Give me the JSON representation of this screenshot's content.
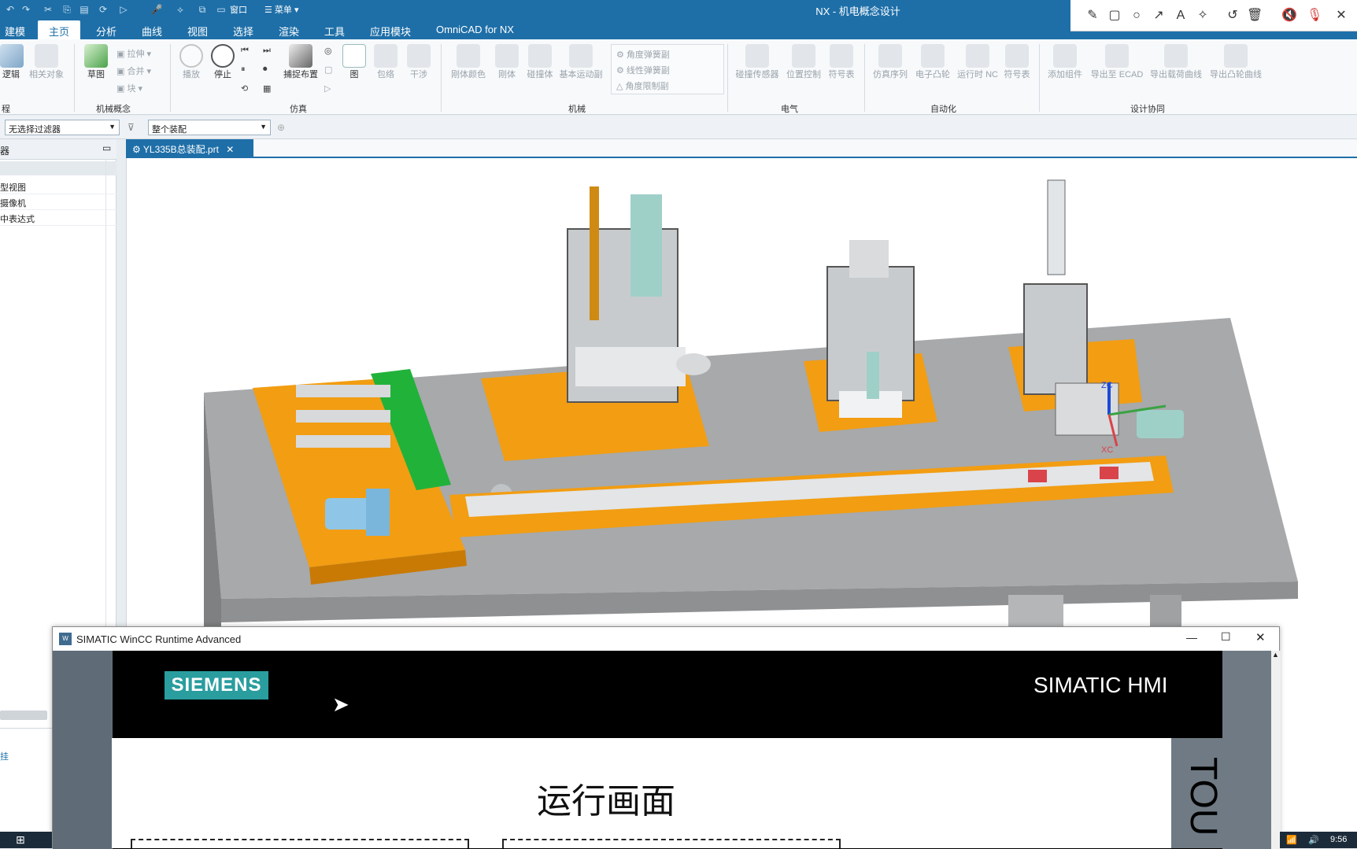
{
  "window": {
    "title": "NX - 机电概念设计",
    "quick_access": {
      "window_menu": "窗口",
      "menu": "菜单"
    }
  },
  "menu_tabs": [
    "建模",
    "主页",
    "分析",
    "曲线",
    "视图",
    "选择",
    "渲染",
    "工具",
    "应用模块",
    "OmniCAD for NX"
  ],
  "active_tab": "主页",
  "ribbon": {
    "groups": {
      "process": "程",
      "mech_concept": "机械概念",
      "simulation": "仿真",
      "mechanical": "机械",
      "electrical": "电气",
      "automation": "自动化",
      "collab": "设计协同"
    },
    "buttons": {
      "logic": "逻辑",
      "related_objects": "相关对象",
      "sketch": "草图",
      "extrude": "拉伸",
      "merge": "合并",
      "block": "块",
      "play": "播放",
      "stop": "停止",
      "capture_layout": "捕捉布置",
      "graph": "图",
      "envelope": "包络",
      "interference": "干涉",
      "body_color": "刚体颜色",
      "rigid_body": "刚体",
      "collision_body": "碰撞体",
      "basic_motion": "基本运动副",
      "angle_spring_damper": "角度弹簧副",
      "linear_spring_damper": "线性弹簧副",
      "angle_limit_damper": "角度限制副",
      "collision_sensor": "碰撞传感器",
      "position_control": "位置控制",
      "symbol_table": "符号表",
      "sim_sequence": "仿真序列",
      "electronic_cam": "电子凸轮",
      "runtime_nc": "运行时 NC",
      "symbol_table_2": "符号表",
      "add_component": "添加组件",
      "export_ecad": "导出至 ECAD",
      "export_load_curve": "导出载荷曲线",
      "export_cam_curve": "导出凸轮曲线"
    }
  },
  "filters": {
    "selection_filter": "无选择过滤器",
    "assembly_scope": "整个装配"
  },
  "navigator": {
    "title": "器",
    "items": [
      "型视图",
      "摄像机",
      "中表达式"
    ],
    "bottom_item": "挂"
  },
  "document_tab": "YL335B总装配.prt",
  "scene": {
    "triad": {
      "zc": "ZC",
      "xc": "XC"
    }
  },
  "wincc": {
    "window_title": "SIMATIC WinCC Runtime Advanced",
    "brand": "SIEMENS",
    "product": "SIMATIC HMI",
    "screen_title": "运行画面",
    "side_text": "TOU"
  },
  "taskbar": {
    "time": "9:56"
  },
  "colors": {
    "nx_blue": "#1e6fa8",
    "siemens_teal": "#2a9d9f",
    "table_orange": "#f7a21a",
    "conveyor_green": "#21b23a"
  }
}
